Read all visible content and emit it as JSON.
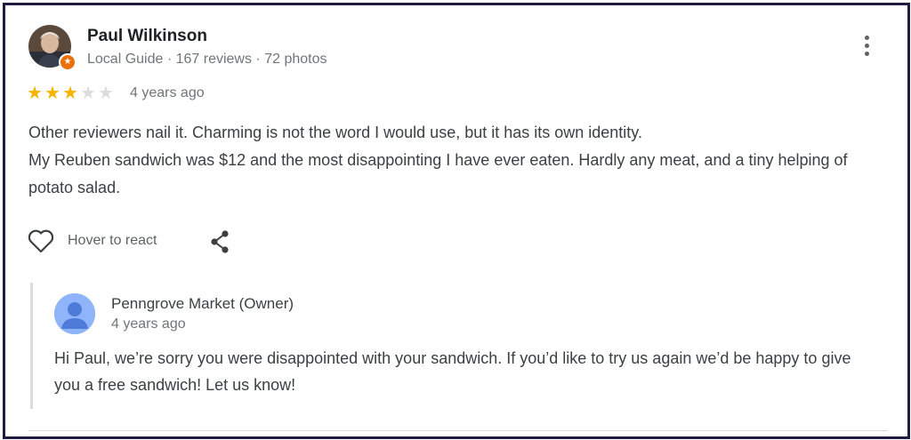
{
  "review": {
    "reviewer_name": "Paul Wilkinson",
    "reviewer_meta": "Local Guide · 167 reviews · 72 photos",
    "rating": 3,
    "rating_max": 5,
    "time": "4 years ago",
    "text_lines": [
      "Other reviewers nail it. Charming is not the word I would use, but it has its own identity.",
      "My Reuben sandwich was $12 and the most disappointing I have ever eaten. Hardly any meat, and a tiny helping of potato salad."
    ],
    "react_label": "Hover to react"
  },
  "owner_reply": {
    "name": "Penngrove Market (Owner)",
    "time": "4 years ago",
    "text": "Hi Paul, we’re sorry you were disappointed with your sandwich. If you’d like to try us again we’d be happy to give you a free sandwich! Let us know!"
  },
  "colors": {
    "star_on": "#f4b400",
    "star_off": "#dadce0",
    "frame": "#1f1d3f",
    "owner_avatar_bg": "#8fb4f9",
    "owner_avatar_fg": "#4e7ad8",
    "local_guide_badge": "#e8710a"
  },
  "icons": {
    "more": "more-vertical-icon",
    "heart": "heart-outline-icon",
    "share": "share-icon",
    "badge": "local-guide-badge-icon"
  }
}
